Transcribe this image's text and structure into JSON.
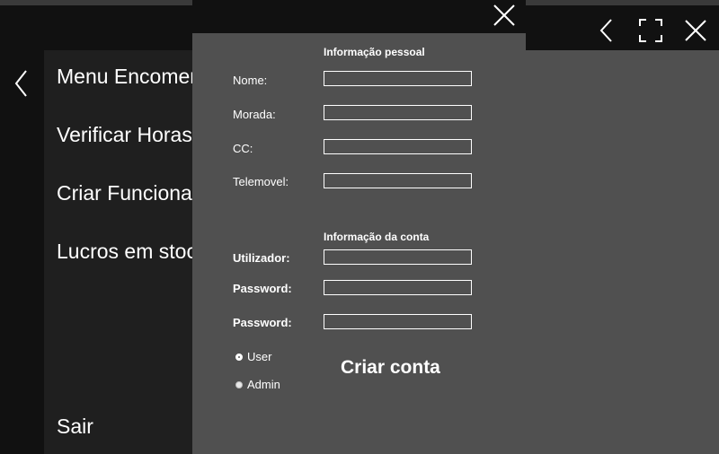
{
  "menu": {
    "items": [
      {
        "label": "Menu Encomendas"
      },
      {
        "label": "Verificar Horas"
      },
      {
        "label": "Criar Funcionario"
      },
      {
        "label": "Lucros em stock"
      }
    ],
    "exit_label": "Sair"
  },
  "dialog": {
    "personal_header": "Informação pessoal",
    "account_header": "Informação da conta",
    "fields": {
      "nome": {
        "label": "Nome:",
        "value": ""
      },
      "morada": {
        "label": "Morada:",
        "value": ""
      },
      "cc": {
        "label": "CC:",
        "value": ""
      },
      "telemovel": {
        "label": "Telemovel:",
        "value": ""
      },
      "utilizador": {
        "label": "Utilizador:",
        "value": ""
      },
      "password": {
        "label": "Password:",
        "value": ""
      },
      "password_confirm": {
        "label": "Password:",
        "value": ""
      }
    },
    "roles": [
      {
        "label": "User",
        "checked": true
      },
      {
        "label": "Admin",
        "checked": false
      }
    ],
    "submit_label": "Criar conta"
  },
  "icons": {
    "back": "chevron-left-icon",
    "fullscreen": "fullscreen-icon",
    "close": "close-icon"
  }
}
